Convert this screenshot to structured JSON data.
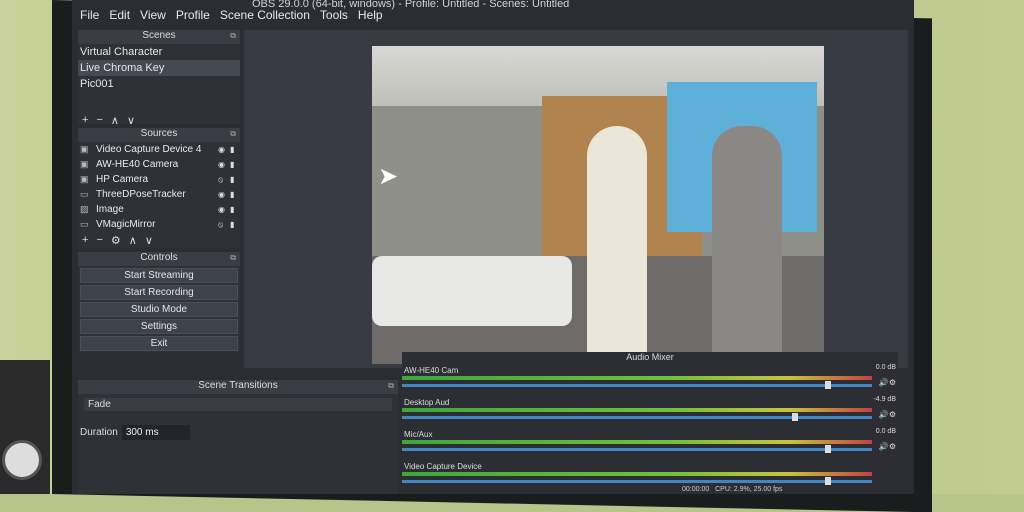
{
  "window": {
    "title": "OBS 29.0.0 (64-bit, windows) - Profile: Untitled - Scenes: Untitled"
  },
  "menu": [
    "File",
    "Edit",
    "View",
    "Profile",
    "Scene Collection",
    "Tools",
    "Help"
  ],
  "scenes": {
    "title": "Scenes",
    "items": [
      "Virtual Character",
      "Live Chroma Key",
      "Pic001"
    ],
    "toolbar": [
      "+",
      "−",
      "∧",
      "∨"
    ]
  },
  "sources": {
    "title": "Sources",
    "items": [
      {
        "name": "Video Capture Device 4",
        "icon": "camera-icon",
        "visible": "◉",
        "locked": "🔒"
      },
      {
        "name": "AW-HE40 Camera",
        "icon": "camera-icon",
        "visible": "◉",
        "locked": "🔒"
      },
      {
        "name": "HP Camera",
        "icon": "camera-icon",
        "visible": "⦸",
        "locked": "🔒"
      },
      {
        "name": "ThreeDPoseTracker",
        "icon": "monitor-icon",
        "visible": "◉",
        "locked": "🔒"
      },
      {
        "name": "Image",
        "icon": "image-icon",
        "visible": "◉",
        "locked": "🔒"
      },
      {
        "name": "VMagicMirror",
        "icon": "monitor-icon",
        "visible": "⦸",
        "locked": "🔒"
      }
    ],
    "toolbar": [
      "+",
      "−",
      "⚙",
      "∧",
      "∨"
    ]
  },
  "controls": {
    "title": "Controls",
    "buttons": [
      "Start Streaming",
      "Start Recording",
      "Studio Mode",
      "Settings",
      "Exit"
    ]
  },
  "scene_transitions": {
    "title": "Scene Transitions",
    "selected": "Fade",
    "duration_label": "Duration",
    "duration_value": "300 ms"
  },
  "audio_mixer": {
    "title": "Audio Mixer",
    "channels": [
      {
        "name": "AW-HE40 Cam",
        "db": "0.0 dB",
        "fader": 0.9
      },
      {
        "name": "Desktop Aud",
        "db": "-4.9 dB",
        "fader": 0.83
      },
      {
        "name": "Mic/Aux",
        "db": "0.0 dB",
        "fader": 0.9
      },
      {
        "name": "Video Capture Device",
        "db": "",
        "fader": 0.9
      }
    ]
  },
  "status": {
    "time": "00:00:00",
    "cpu": "CPU: 2.9%, 25.00 fps"
  }
}
